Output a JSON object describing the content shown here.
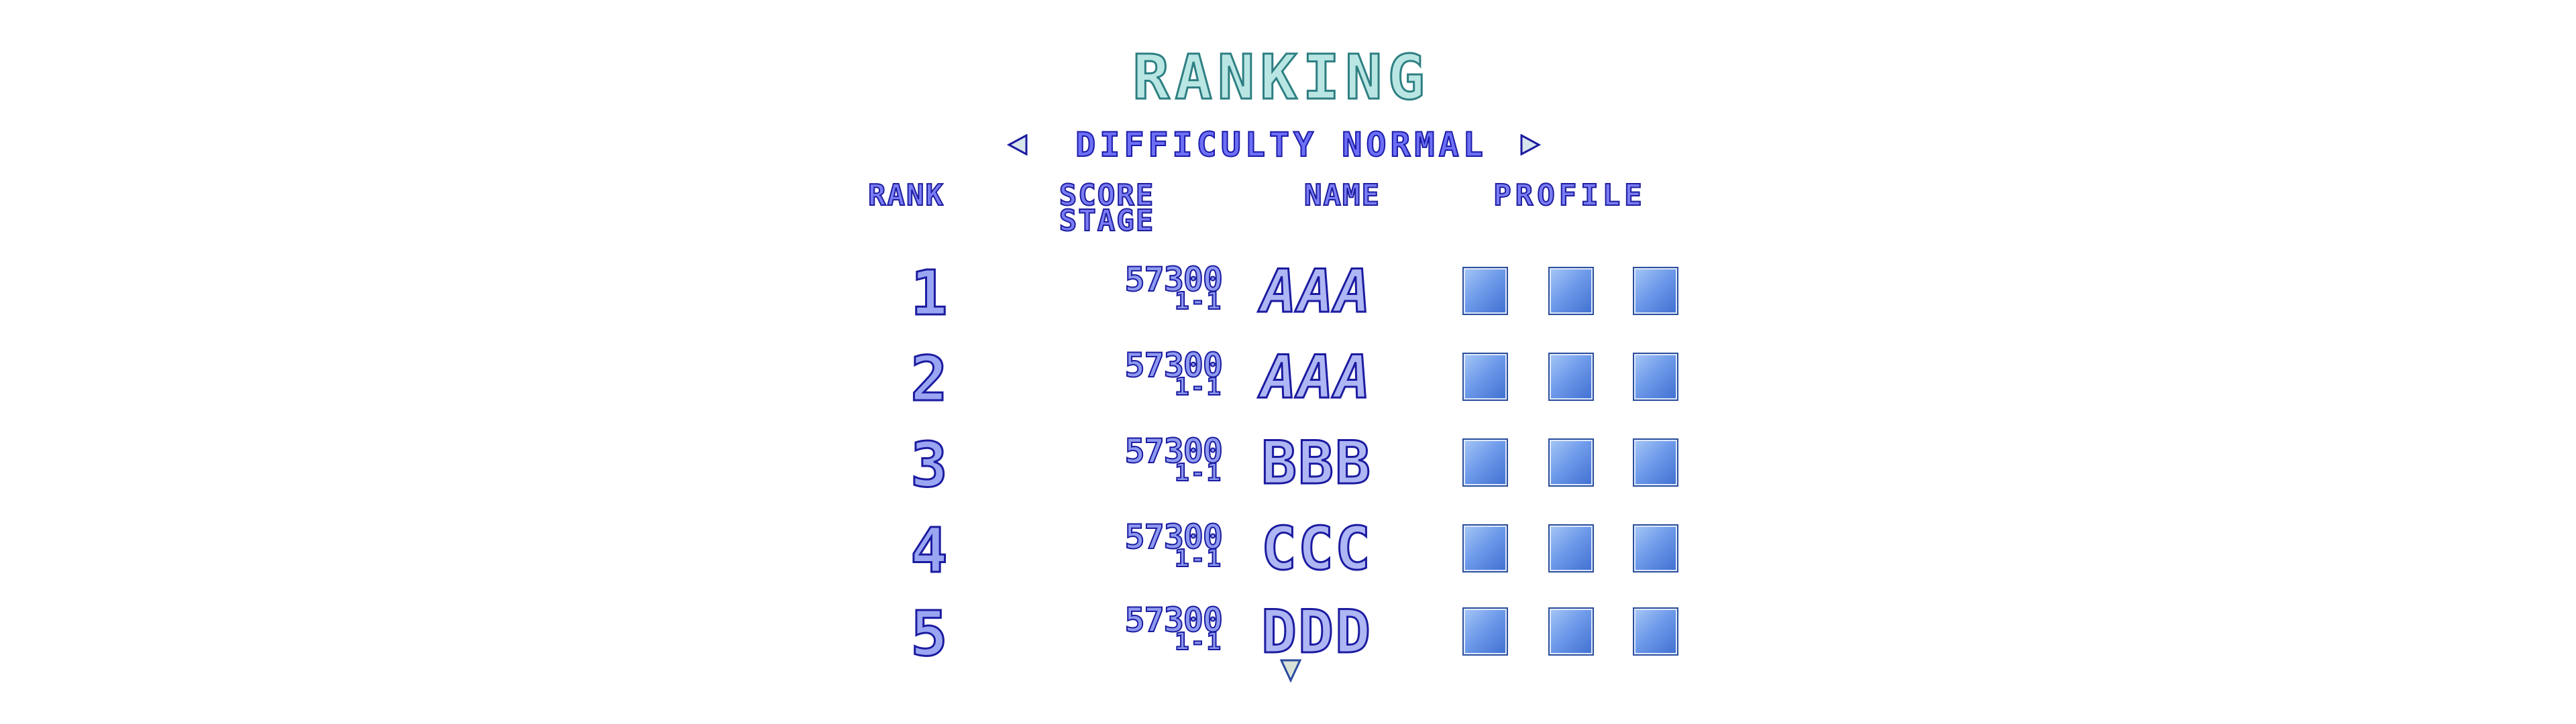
{
  "title": "RANKING",
  "difficulty": {
    "label": "DIFFICULTY NORMAL",
    "prev_icon": "triangle-left-icon",
    "next_icon": "triangle-right-icon"
  },
  "columns": {
    "rank": "RANK",
    "score": "SCORE",
    "stage": "STAGE",
    "name": "NAME",
    "profile": "PROFILE"
  },
  "rows": [
    {
      "rank": "1",
      "score": "57300",
      "stage": "1-1",
      "name": "AAA"
    },
    {
      "rank": "2",
      "score": "57300",
      "stage": "1-1",
      "name": "AAA"
    },
    {
      "rank": "3",
      "score": "57300",
      "stage": "1-1",
      "name": "BBB"
    },
    {
      "rank": "4",
      "score": "57300",
      "stage": "1-1",
      "name": "CCC"
    },
    {
      "rank": "5",
      "score": "57300",
      "stage": "1-1",
      "name": "DDD"
    }
  ],
  "scroll_icon": "triangle-down-icon",
  "colors": {
    "title_fill": "#b9e6e3",
    "title_stroke": "#2e7f82",
    "text_blue": "#1b1ba0",
    "profile_box": "#6f9bea"
  }
}
